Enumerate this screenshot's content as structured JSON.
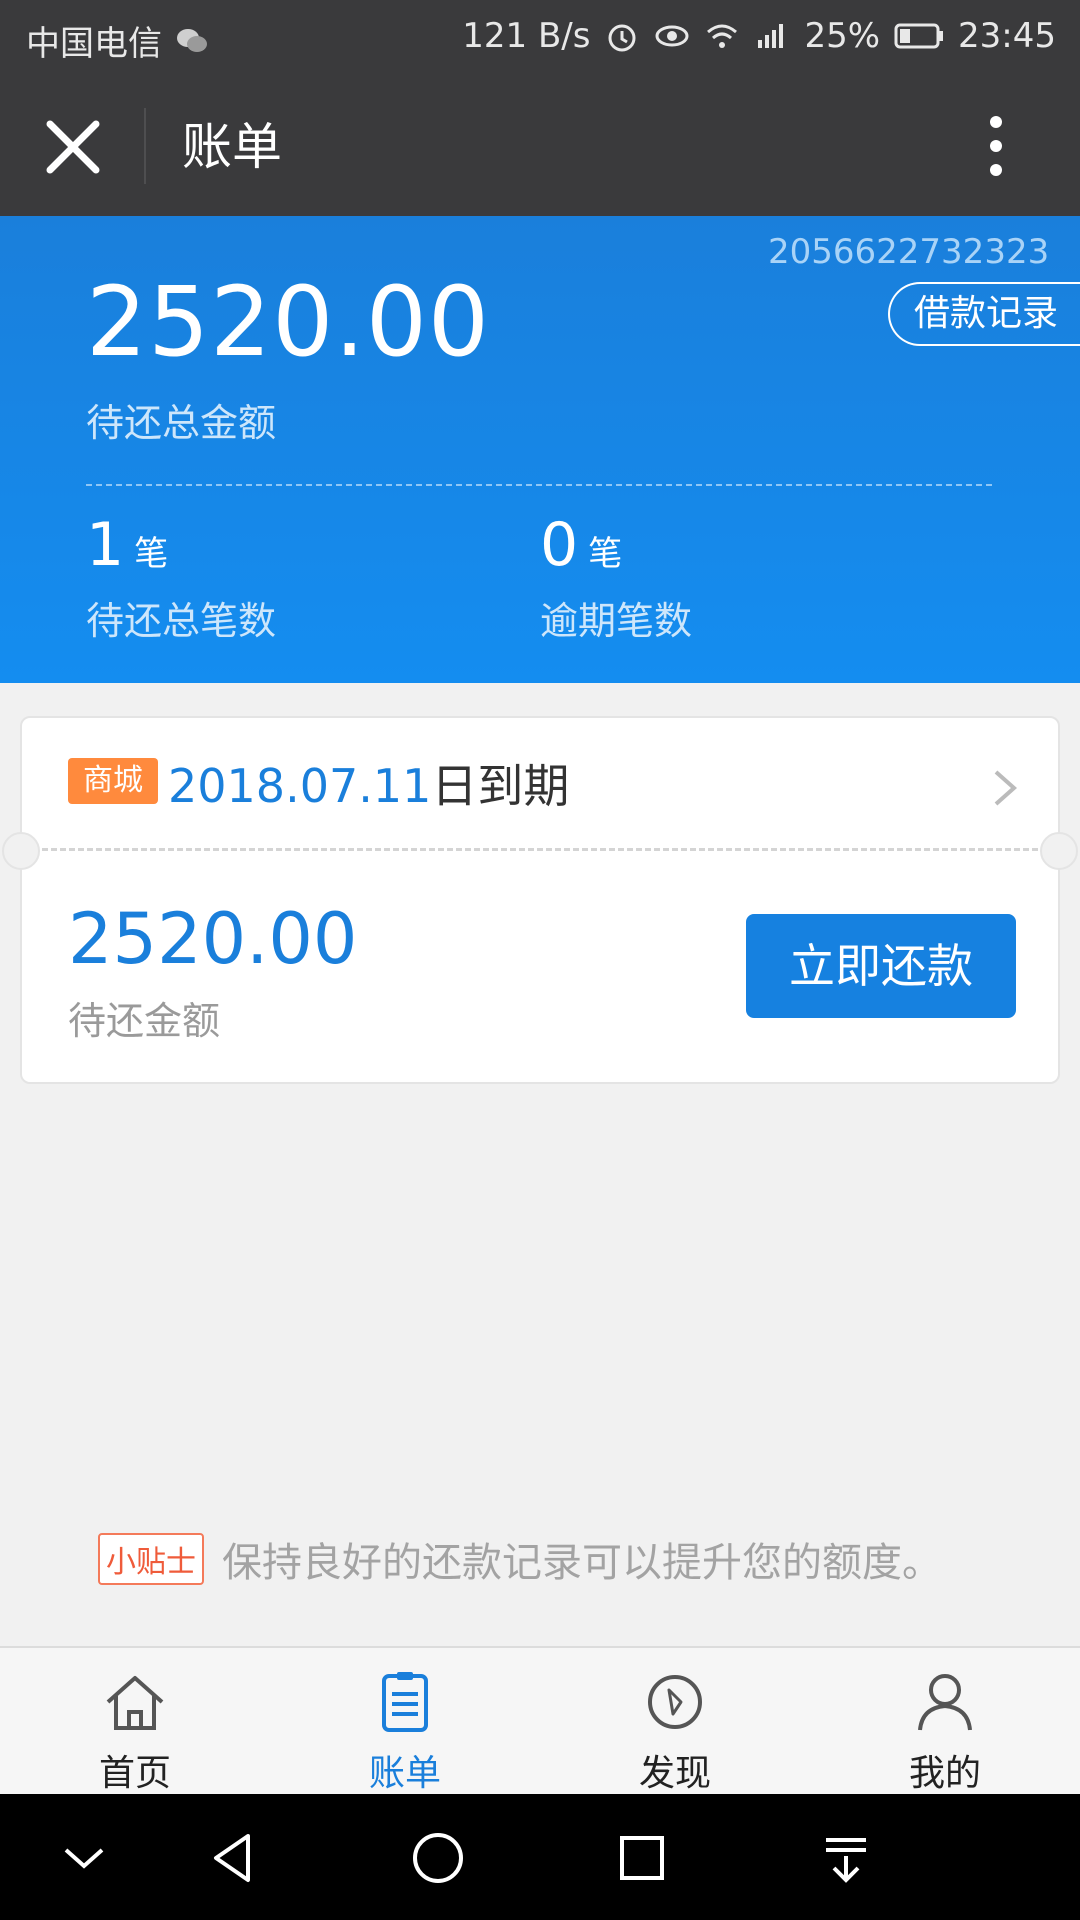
{
  "status_bar": {
    "carrier": "中国电信",
    "net_speed": "121 B/s",
    "battery_percent": "25%",
    "time": "23:45"
  },
  "title_bar": {
    "title": "账单"
  },
  "summary": {
    "bill_number": "2056622732323",
    "loan_record_label": "借款记录",
    "total_amount": "2520.00",
    "total_amount_label": "待还总金额",
    "pending_count": "1",
    "pending_unit": "笔",
    "pending_label": "待还总笔数",
    "overdue_count": "0",
    "overdue_unit": "笔",
    "overdue_label": "逾期笔数"
  },
  "bill_card": {
    "tag": "商城",
    "due_date": "2018.07.11",
    "due_suffix": "日到期",
    "amount": "2520.00",
    "amount_label": "待还金额",
    "pay_button": "立即还款"
  },
  "tip": {
    "badge": "小贴士",
    "text": "保持良好的还款记录可以提升您的额度。"
  },
  "bottom_nav": {
    "items": [
      {
        "label": "首页",
        "icon": "home-icon"
      },
      {
        "label": "账单",
        "icon": "bill-icon",
        "active": true
      },
      {
        "label": "发现",
        "icon": "compass-icon"
      },
      {
        "label": "我的",
        "icon": "user-icon"
      }
    ]
  },
  "colors": {
    "accent": "#1a7fdb",
    "header_bg": "#3a3a3c",
    "tag_orange": "#ff8a3d"
  }
}
